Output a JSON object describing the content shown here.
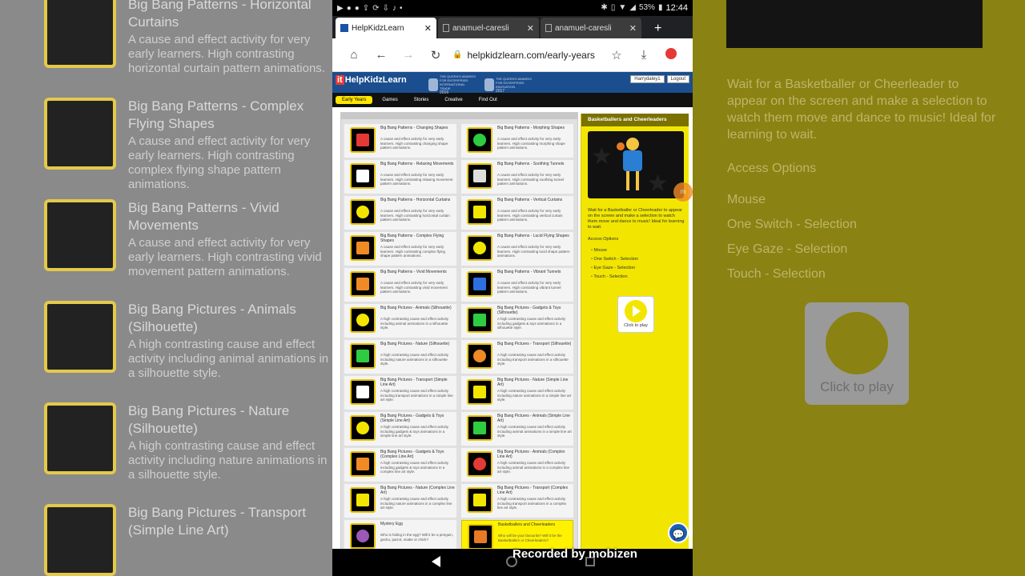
{
  "status": {
    "time": "12:44",
    "battery": "53%"
  },
  "tabs": [
    {
      "title": "HelpKidzLearn",
      "active": true
    },
    {
      "title": "anamuel-caresli",
      "active": false
    },
    {
      "title": "anamuel-caresli",
      "active": false
    }
  ],
  "browser": {
    "url": "helpkidzlearn.com/early-years",
    "new_tab": "+"
  },
  "site": {
    "logo": "HelpKidzLearn",
    "logo_mark": "it",
    "awards": [
      {
        "line": "THE QUEEN'S AWARDS FOR ENTERPRISE: INTERNATIONAL TRADE",
        "year": "2016"
      },
      {
        "line": "THE QUEEN'S AWARDS FOR ENTERPRISE: INNOVATION",
        "year": "2017"
      }
    ],
    "username": "Harrydaley1",
    "logout": "Logout",
    "nav": [
      "Early Years",
      "Games",
      "Stories",
      "Creative",
      "Find Out"
    ]
  },
  "activities": [
    {
      "title": "Big Bang Patterns - Changing Shapes",
      "desc": "A cause and effect activity for very early learners. High contrasting changing shape pattern animations.",
      "color": "#e53935"
    },
    {
      "title": "Big Bang Patterns - Morphing Shapes",
      "desc": "A cause and effect activity for very early learners. High contrasting morphing shape pattern animations.",
      "color": "#2ecc40"
    },
    {
      "title": "Big Bang Patterns - Relaxing Movements",
      "desc": "A cause and effect activity for very early learners. High contrasting relaxing movement pattern animations.",
      "color": "#ffffff"
    },
    {
      "title": "Big Bang Patterns - Soothing Tunnels",
      "desc": "A cause and effect activity for very early learners. High contrasting soothing tunnel pattern animations.",
      "color": "#dddddd"
    },
    {
      "title": "Big Bang Patterns - Horizontal Curtains",
      "desc": "A cause and effect activity for very early learners. High contrasting horizontal curtain pattern animations.",
      "color": "#f2e600"
    },
    {
      "title": "Big Bang Patterns - Vertical Curtains",
      "desc": "A cause and effect activity for very early learners. High contrasting vertical curtain pattern animations.",
      "color": "#f2e600"
    },
    {
      "title": "Big Bang Patterns - Complex Flying Shapes",
      "desc": "A cause and effect activity for very early learners. High contrasting complex flying shape pattern animations.",
      "color": "#f08a24"
    },
    {
      "title": "Big Bang Patterns - Lucid Flying Shapes",
      "desc": "A cause and effect activity for very early learners. High contrasting lucid shape pattern animations.",
      "color": "#f2e600"
    },
    {
      "title": "Big Bang Patterns - Vivid Movements",
      "desc": "A cause and effect activity for very early learners. High contrasting vivid movement pattern animations.",
      "color": "#f08a24"
    },
    {
      "title": "Big Bang Patterns - Vibrant Tunnels",
      "desc": "A cause and effect activity for very early learners. High contrasting vibrant tunnel pattern animations.",
      "color": "#2b6fe0"
    },
    {
      "title": "Big Bang Pictures - Animals (Silhouette)",
      "desc": "A high contrasting cause and effect activity including animal animations in a silhouette style.",
      "color": "#f2e600"
    },
    {
      "title": "Big Bang Pictures - Gadgets & Toys (Silhouette)",
      "desc": "A high contrasting cause and effect activity including gadgets & toys animations in a silhouette style.",
      "color": "#2ecc40"
    },
    {
      "title": "Big Bang Pictures - Nature (Silhouette)",
      "desc": "A high contrasting cause and effect activity including nature animations in a silhouette style.",
      "color": "#2ecc40"
    },
    {
      "title": "Big Bang Pictures - Transport (Silhouette)",
      "desc": "A high contrasting cause and effect activity including transport animations in a silhouette style.",
      "color": "#f08a24"
    },
    {
      "title": "Big Bang Pictures - Transport (Simple Line Art)",
      "desc": "A high contrasting cause and effect activity including transport animations in a simple line art style.",
      "color": "#ffffff"
    },
    {
      "title": "Big Bang Pictures - Nature (Simple Line Art)",
      "desc": "A high contrasting cause and effect activity including nature animations in a simple line art style.",
      "color": "#f2e600"
    },
    {
      "title": "Big Bang Pictures - Gadgets & Toys (Simple Line Art)",
      "desc": "A high contrasting cause and effect activity including gadgets & toys animations in a simple line art style.",
      "color": "#f2e600"
    },
    {
      "title": "Big Bang Pictures - Animals (Simple Line Art)",
      "desc": "A high contrasting cause and effect activity including animal animations in a simple line art style.",
      "color": "#2ecc40"
    },
    {
      "title": "Big Bang Pictures - Gadgets & Toys (Complex Line Art)",
      "desc": "A high contrasting cause and effect activity including gadgets & toys animations in a complex line art style.",
      "color": "#f08a24"
    },
    {
      "title": "Big Bang Pictures - Animals (Complex Line Art)",
      "desc": "A high contrasting cause and effect activity including animal animations in a complex line art style.",
      "color": "#e53935"
    },
    {
      "title": "Big Bang Pictures - Nature (Complex Line Art)",
      "desc": "A high contrasting cause and effect activity including nature animations in a complex line art style.",
      "color": "#f2e600"
    },
    {
      "title": "Big Bang Pictures - Transport (Complex Line Art)",
      "desc": "A high contrasting cause and effect activity including transport animations in a complex line art style.",
      "color": "#f2e600"
    },
    {
      "title": "Mystery Egg",
      "desc": "Who is hiding in the egg? Will it be a penguin, gecko, parrot, snake or chick?",
      "color": "#9b59b6"
    },
    {
      "title": "Basketballers and Cheerleaders",
      "desc": "Who will be your favourite? Will it be the Basketballers or Cheerleaders?",
      "color": "#e87a24",
      "highlighted": true
    }
  ],
  "detail": {
    "title": "Basketballers and Cheerleaders",
    "description": "Wait for a Basketballer or Cheerleader to appear on the screen and make a selection to watch them move and dance to music! Ideal for learning to wait.",
    "access_heading": "Access Options",
    "access_options": [
      "Mouse",
      "One Switch - Selection",
      "Eye Gaze - Selection",
      "Touch - Selection"
    ],
    "play_label": "Click to play"
  },
  "backdrop": {
    "left_items": [
      {
        "title": "Big Bang Patterns - Horizontal Curtains",
        "desc": "A cause and effect activity for very early learners. High contrasting horizontal curtain pattern animations."
      },
      {
        "title": "Big Bang Patterns - Complex Flying Shapes",
        "desc": "A cause and effect activity for very early learners. High contrasting complex flying shape pattern animations."
      },
      {
        "title": "Big Bang Patterns - Vivid Movements",
        "desc": "A cause and effect activity for very early learners. High contrasting vivid movement pattern animations."
      },
      {
        "title": "Big Bang Pictures - Animals (Silhouette)",
        "desc": "A high contrasting cause and effect activity including animal animations in a silhouette style."
      },
      {
        "title": "Big Bang Pictures - Nature (Silhouette)",
        "desc": "A high contrasting cause and effect activity including nature animations in a silhouette style."
      },
      {
        "title": "Big Bang Pictures - Transport (Simple Line Art)",
        "desc": ""
      }
    ]
  },
  "watermark": "Recorded by mobizen",
  "mobizen_badge": "m"
}
